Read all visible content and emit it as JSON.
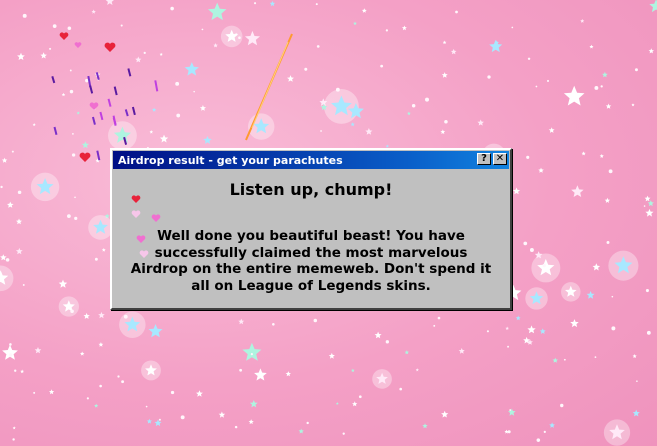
{
  "dialog": {
    "title": "Airdrop result - get your parachutes",
    "help_button": "?",
    "close_button": "✕",
    "heading": "Listen up, chump!",
    "message": "Well done you beautiful beast! You have successfully claimed the most marvelous Airdrop on the entire memeweb. Don't spend it all on League of Legends skins."
  },
  "colors": {
    "background": "#f5a3c7",
    "titlebar_start": "#000f85",
    "titlebar_end": "#1183e0",
    "dialog_face": "#c0c0c0"
  }
}
